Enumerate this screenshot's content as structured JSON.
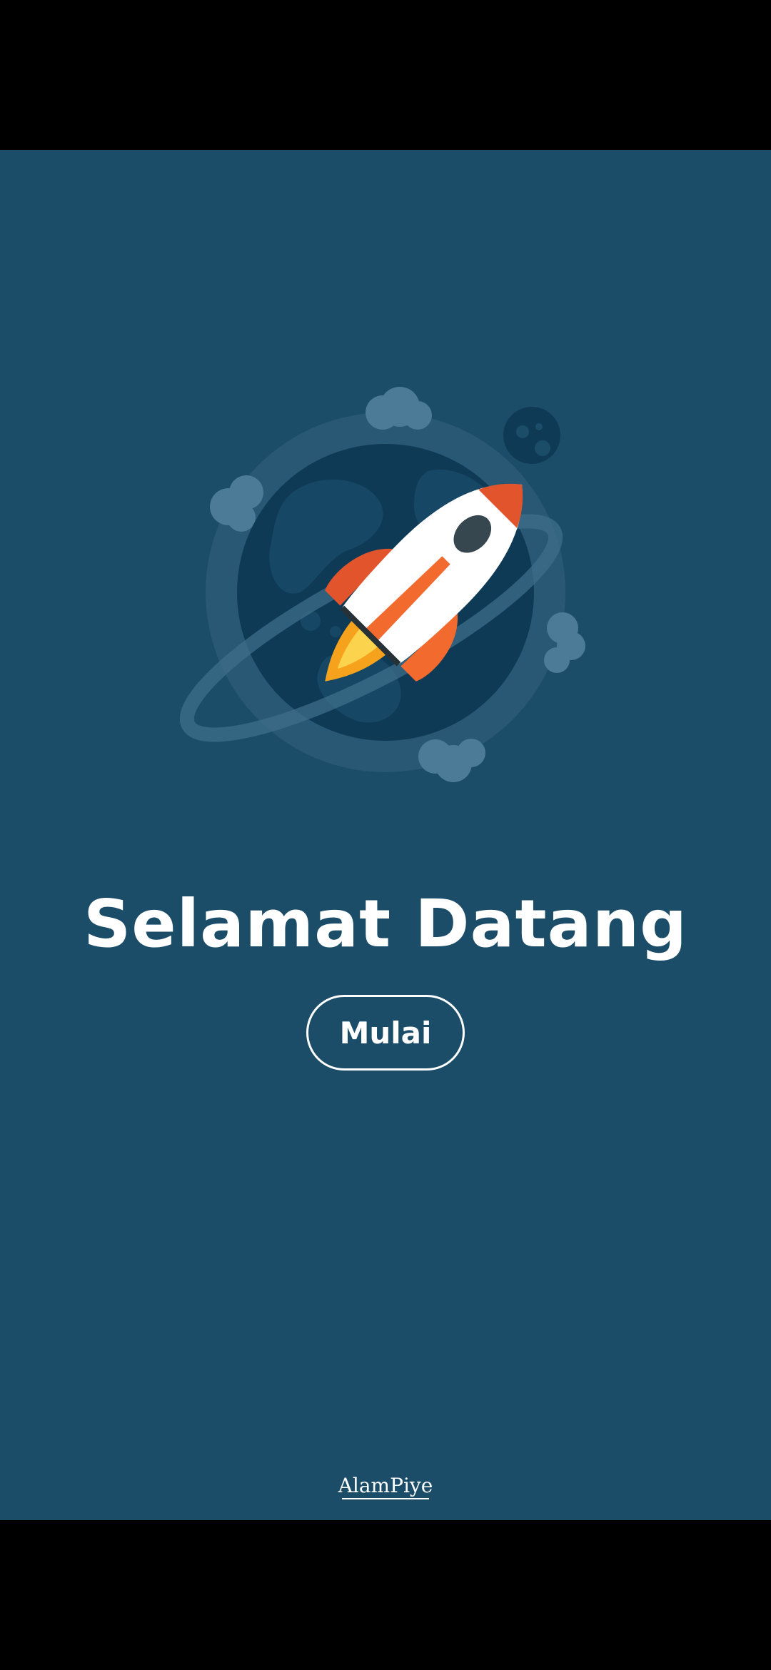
{
  "screen": {
    "background_color": "#1b4d69",
    "system_bar_color": "#000000"
  },
  "illustration": {
    "icon": "rocket-planet-icon"
  },
  "welcome": {
    "title": "Selamat Datang",
    "start_button_label": "Mulai"
  },
  "brand": {
    "logo_text": "AlamPiye"
  }
}
